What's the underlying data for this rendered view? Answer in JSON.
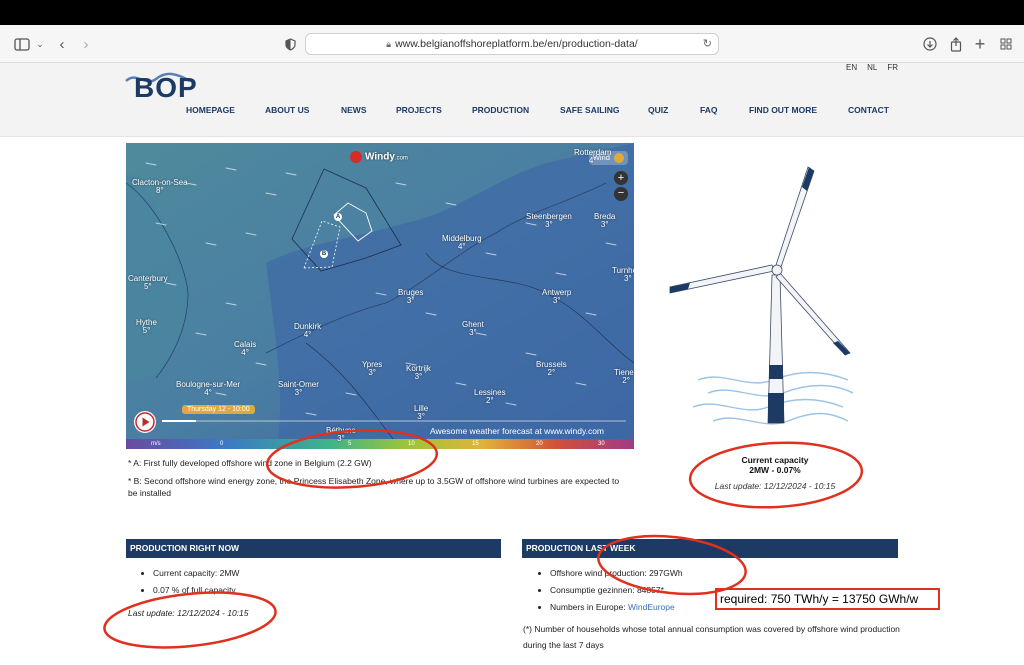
{
  "browser": {
    "url": "www.belgianoffshoreplatform.be/en/production-data/"
  },
  "header": {
    "logo_text": "BOP",
    "languages": [
      "EN",
      "NL",
      "FR"
    ],
    "nav": [
      "HOMEPAGE",
      "ABOUT US",
      "NEWS",
      "PROJECTS",
      "PRODUCTION",
      "SAFE SAILING",
      "QUIZ",
      "FAQ",
      "FIND OUT MORE",
      "CONTACT"
    ]
  },
  "map": {
    "brand": "Windy",
    "brand_suffix": ".com",
    "layer_label": "Wind",
    "time_label": "Thursday 12 - 10:00",
    "forecast_text": "Awesome weather forecast at www.windy.com",
    "scale_unit": "m/s",
    "scale_ticks": [
      "0",
      "5",
      "10",
      "15",
      "20",
      "30"
    ],
    "zone_a": "A",
    "zone_b": "B",
    "places": [
      {
        "name": "Rotterdam",
        "temp": "4°"
      },
      {
        "name": "Clacton-on-Sea",
        "temp": "8°"
      },
      {
        "name": "Steenbergen",
        "temp": "3°"
      },
      {
        "name": "Breda",
        "temp": "3°"
      },
      {
        "name": "Middelburg",
        "temp": "4°"
      },
      {
        "name": "Turnhout",
        "temp": "3°"
      },
      {
        "name": "Canterbury",
        "temp": "5°"
      },
      {
        "name": "Bruges",
        "temp": "3°"
      },
      {
        "name": "Antwerp",
        "temp": "3°"
      },
      {
        "name": "Hythe",
        "temp": "5°"
      },
      {
        "name": "Dunkirk",
        "temp": "4°"
      },
      {
        "name": "Ghent",
        "temp": "3°"
      },
      {
        "name": "Calais",
        "temp": "4°"
      },
      {
        "name": "Ypres",
        "temp": "3°"
      },
      {
        "name": "Kortrijk",
        "temp": "3°"
      },
      {
        "name": "Brussels",
        "temp": "2°"
      },
      {
        "name": "Tienen",
        "temp": "2°"
      },
      {
        "name": "Boulogne-sur-Mer",
        "temp": "4°"
      },
      {
        "name": "Saint-Omer",
        "temp": "3°"
      },
      {
        "name": "Lessines",
        "temp": "2°"
      },
      {
        "name": "Lille",
        "temp": "3°"
      },
      {
        "name": "Béthune",
        "temp": "3°"
      }
    ]
  },
  "captions": {
    "a": "* A: First fully developed offshore wind zone in Belgium (2.2 GW)",
    "b": "* B: Second offshore wind energy zone, the Princess Elisabeth Zone, where up to 3.5GW of offshore wind turbines are expected to be installed"
  },
  "capacity": {
    "title": "Current capacity",
    "value": "2MW - 0.07%",
    "update": "Last update: 12/12/2024 - 10:15"
  },
  "right_now": {
    "title": "PRODUCTION RIGHT NOW",
    "items": [
      "Current capacity: 2MW",
      "0.07 % of full capacity"
    ],
    "update": "Last update: 12/12/2024 - 10:15"
  },
  "last_week": {
    "title": "PRODUCTION LAST WEEK",
    "items": [
      "Offshore wind production: 297GWh",
      "Consumptie gezinnen: 84857*"
    ],
    "europe_label": "Numbers in Europe: ",
    "europe_link": "WindEurope",
    "note": "(*) Number of households whose total annual consumption was covered by offshore wind production during the last 7 days"
  },
  "annotation": {
    "text": "required: 750 TWh/y = 13750 GWh/w"
  },
  "colors": {
    "navy": "#1c3a63",
    "annotation_red": "#e0301e",
    "link": "#3a6fb5"
  }
}
